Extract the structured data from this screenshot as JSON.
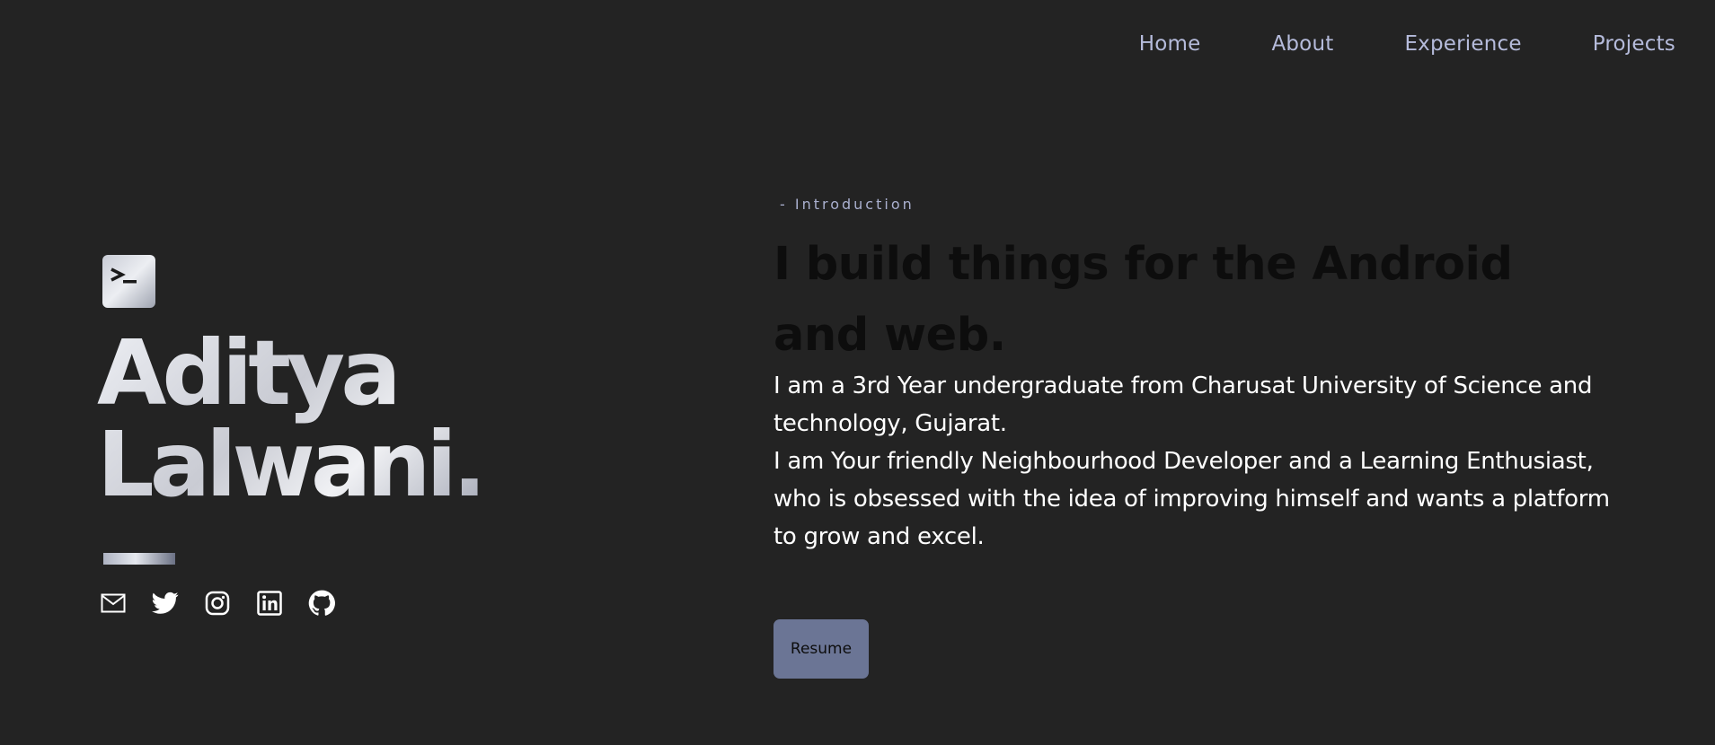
{
  "nav": {
    "items": [
      {
        "label": "Home"
      },
      {
        "label": "About"
      },
      {
        "label": "Experience"
      },
      {
        "label": "Projects"
      }
    ]
  },
  "hero": {
    "logo_icon": "terminal-icon",
    "name_line1": "Aditya",
    "name_line2": "Lalwani.",
    "socials": [
      {
        "icon": "mail-icon"
      },
      {
        "icon": "twitter-icon"
      },
      {
        "icon": "instagram-icon"
      },
      {
        "icon": "linkedin-icon"
      },
      {
        "icon": "github-icon"
      }
    ]
  },
  "intro": {
    "label": "- Introduction",
    "headline": "I build things for the Android and web.",
    "bio_line1": "I am a 3rd Year undergraduate from Charusat University of Science and technology, Gujarat.",
    "bio_line2": "I am Your friendly Neighbourhood Developer  and a Learning Enthusiast,  who is obsessed with the idea of improving himself and wants a platform to grow and excel.",
    "resume_label": "Resume"
  },
  "colors": {
    "background": "#232323",
    "nav_text": "#b5bbdb",
    "button": "#6b7595"
  }
}
